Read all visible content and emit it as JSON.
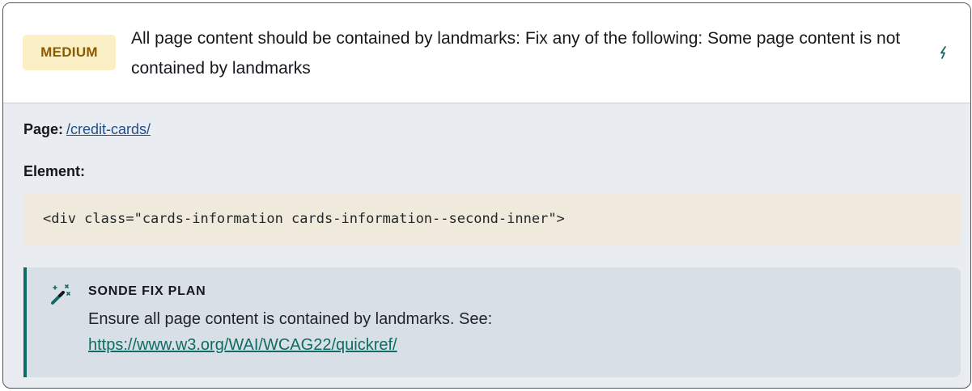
{
  "issue": {
    "severity": "MEDIUM",
    "title": "All page content should be contained by landmarks: Fix any of the following: Some page content is not contained by landmarks",
    "expand_icon": "lightning-icon"
  },
  "details": {
    "page_label": "Page:",
    "page_link": "/credit-cards/",
    "element_label": "Element:",
    "element_code": "<div class=\"cards-information cards-information--second-inner\">"
  },
  "fix_plan": {
    "icon": "magic-wand-icon",
    "heading": "SONDE FIX PLAN",
    "text": "Ensure all page content is contained by landmarks. See:",
    "link": "https://www.w3.org/WAI/WCAG22/quickref/"
  },
  "colors": {
    "accent": "#0f6b63",
    "badge_bg": "#fbefc6",
    "badge_text": "#8a5a00",
    "code_bg": "#efeadb"
  }
}
